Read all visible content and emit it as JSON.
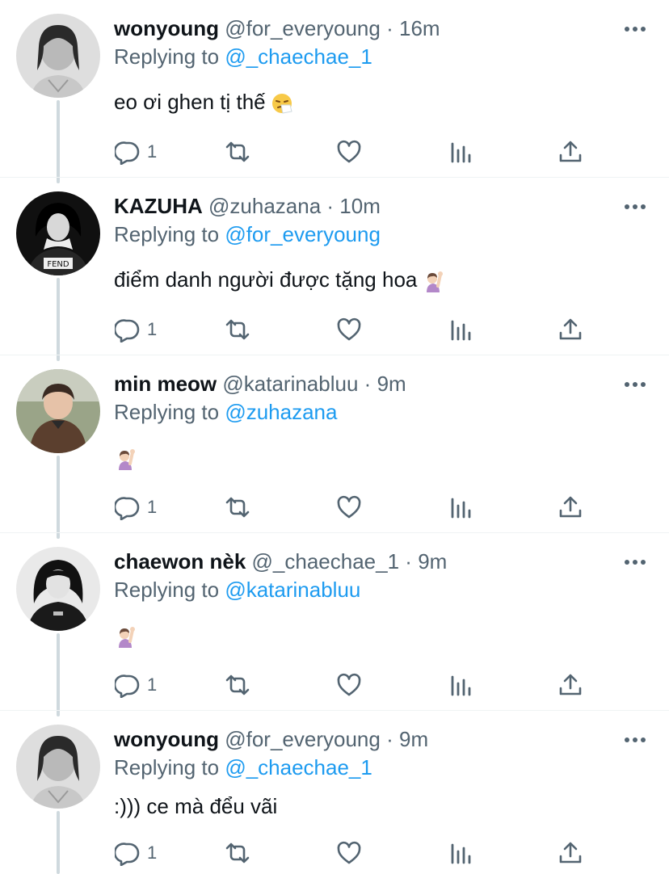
{
  "reply_prefix": "Replying to",
  "tweets": [
    {
      "name": "wonyoung",
      "handle": "@for_everyoung",
      "dot": "·",
      "time": "16m",
      "reply_to": "@_chaechae_1",
      "text": "eo ơi ghen tị thế",
      "emoji": "sneezing-face-emoji",
      "reply_count": "1",
      "avatar": "avatar-wonyoung"
    },
    {
      "name": "KAZUHA",
      "handle": "@zuhazana",
      "dot": "·",
      "time": "10m",
      "reply_to": "@for_everyoung",
      "text": "điểm danh người được tặng hoa",
      "emoji": "raising-hand-emoji",
      "reply_count": "1",
      "avatar": "avatar-kazuha"
    },
    {
      "name": "min meow",
      "handle": "@katarinabluu",
      "dot": "·",
      "time": "9m",
      "reply_to": "@zuhazana",
      "text": "",
      "emoji": "raising-hand-emoji",
      "reply_count": "1",
      "avatar": "avatar-min-meow"
    },
    {
      "name": "chaewon nèk",
      "handle": "@_chaechae_1",
      "dot": "·",
      "time": "9m",
      "reply_to": "@katarinabluu",
      "text": "",
      "emoji": "raising-hand-emoji",
      "reply_count": "1",
      "avatar": "avatar-chaewon"
    },
    {
      "name": "wonyoung",
      "handle": "@for_everyoung",
      "dot": "·",
      "time": "9m",
      "reply_to": "@_chaechae_1",
      "text": ":))) ce mà đểu vãi",
      "emoji": "",
      "reply_count": "1",
      "avatar": "avatar-wonyoung"
    }
  ],
  "colors": {
    "link": "#1d9bf0",
    "secondary_text": "#536471",
    "thread_line": "#cfd9de",
    "icon": "#536471"
  }
}
